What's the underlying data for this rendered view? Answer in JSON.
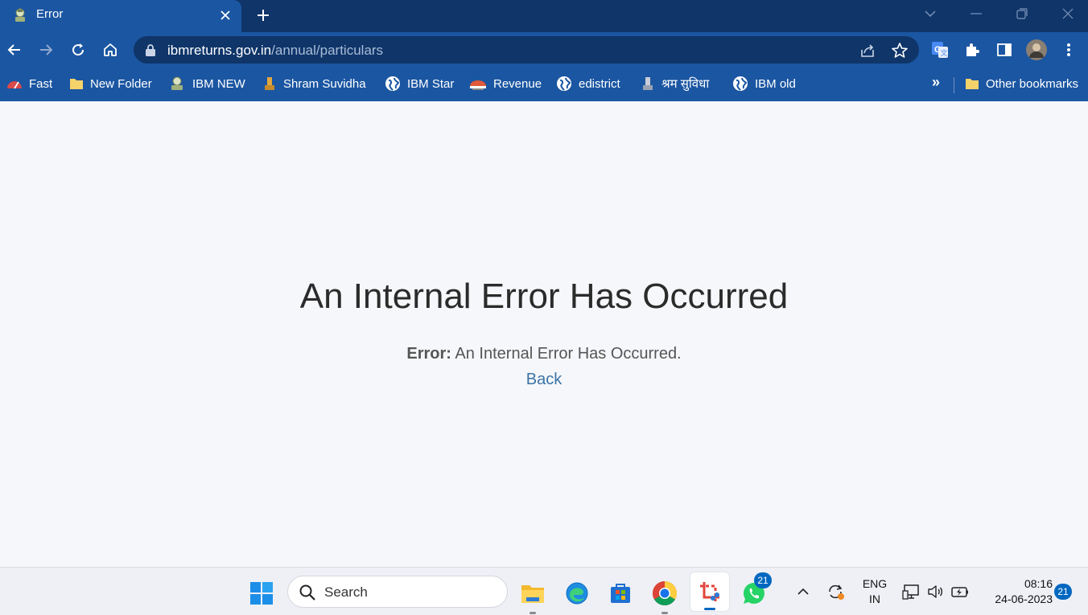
{
  "browser": {
    "tab": {
      "title": "Error"
    },
    "address": {
      "host": "ibmreturns.gov.in",
      "path": "/annual/particulars"
    },
    "bookmarks": [
      {
        "label": "Fast",
        "icon": "fast-icon"
      },
      {
        "label": "New Folder",
        "icon": "folder-icon"
      },
      {
        "label": "IBM NEW",
        "icon": "emblem-icon"
      },
      {
        "label": "Shram Suvidha",
        "icon": "emblem-icon"
      },
      {
        "label": "IBM Star",
        "icon": "globe-icon"
      },
      {
        "label": "Revenue",
        "icon": "revenue-icon"
      },
      {
        "label": "edistrict",
        "icon": "globe-icon"
      },
      {
        "label": "श्रम सुविधा",
        "icon": "emblem-icon"
      },
      {
        "label": "IBM old",
        "icon": "globe-icon"
      }
    ],
    "bookmarks_more": "»",
    "other_bookmarks": "Other bookmarks"
  },
  "page": {
    "title": "An Internal Error Has Occurred",
    "error_label": "Error:",
    "error_text": "An Internal Error Has Occurred.",
    "back_label": "Back"
  },
  "taskbar": {
    "search_placeholder": "Search",
    "whatsapp_badge": "21",
    "language_line1": "ENG",
    "language_line2": "IN",
    "time": "08:16",
    "date": "24-06-2023",
    "notification_count": "21"
  },
  "colors": {
    "tabstrip": "#0f3569",
    "toolbar": "#1b56a2",
    "page_background": "#f6f7fa",
    "link": "#3b73a6",
    "taskbar": "#eef0f6",
    "badge": "#0067c0"
  }
}
